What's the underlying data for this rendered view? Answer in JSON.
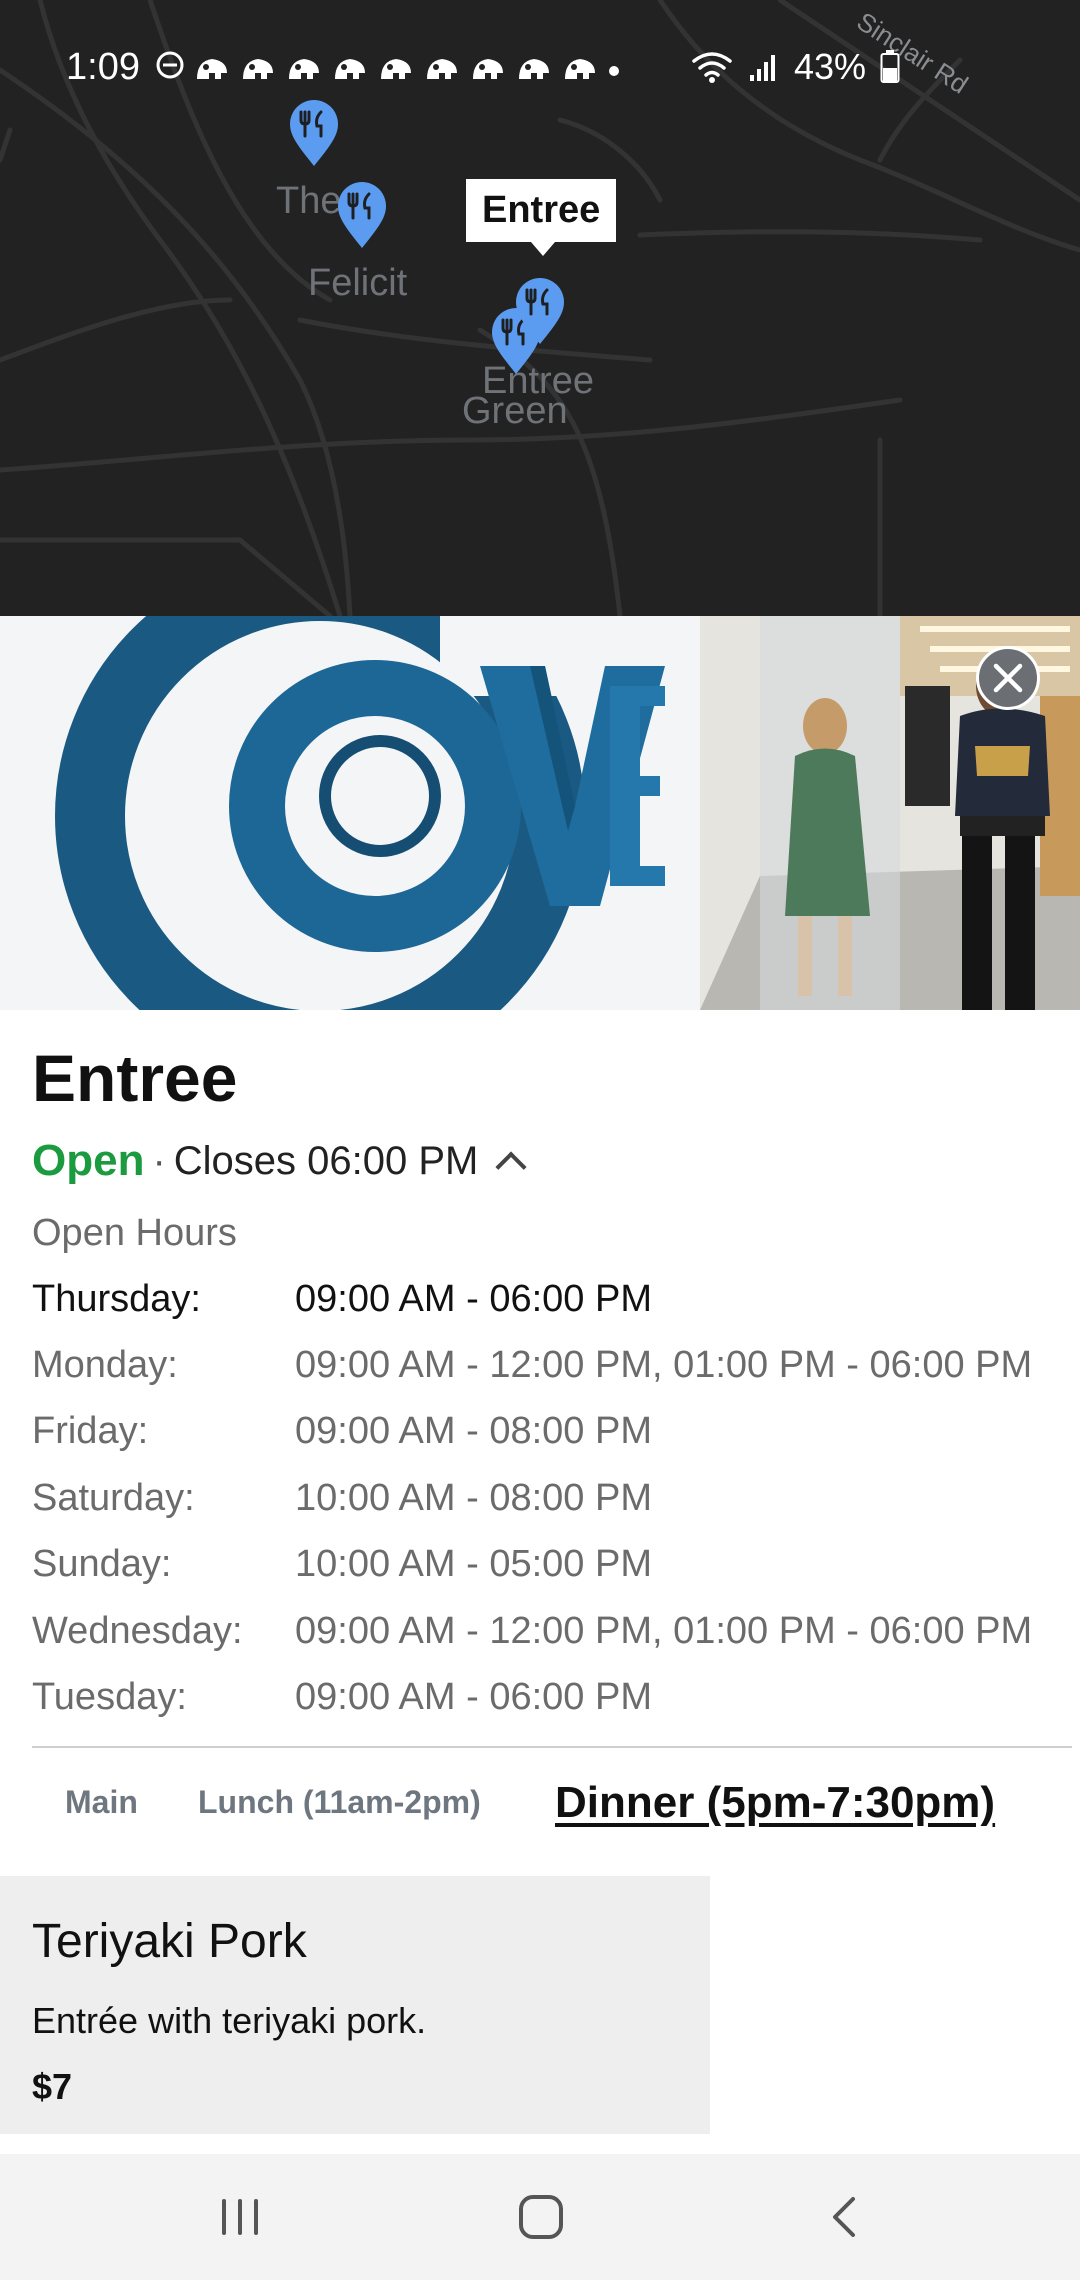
{
  "status_bar": {
    "time": "1:09",
    "battery": "43%",
    "notification_count": 9
  },
  "map": {
    "callout": "Entree",
    "road_label": "Sinclair Rd",
    "labels": [
      "The",
      "Felicit",
      "Entree",
      "Green"
    ],
    "pin_color": "#5b9cf0",
    "pin_icon": "fork-knife-icon"
  },
  "hero": {
    "sign_text": "COVE",
    "close_icon": "close-icon"
  },
  "place": {
    "name": "Entree",
    "open_state": "Open",
    "separator": "·",
    "closes_text": "Closes 06:00 PM",
    "open_color": "#1c9a3f"
  },
  "hours": {
    "heading": "Open Hours",
    "rows": [
      {
        "day": "Thursday:",
        "time": "09:00 AM - 06:00 PM"
      },
      {
        "day": "Monday:",
        "time": "09:00 AM - 12:00 PM, 01:00 PM - 06:00 PM"
      },
      {
        "day": "Friday:",
        "time": "09:00 AM - 08:00 PM"
      },
      {
        "day": "Saturday:",
        "time": "10:00 AM - 08:00 PM"
      },
      {
        "day": "Sunday:",
        "time": "10:00 AM - 05:00 PM"
      },
      {
        "day": "Wednesday:",
        "time": "09:00 AM - 12:00 PM, 01:00 PM - 06:00 PM"
      },
      {
        "day": "Tuesday:",
        "time": "09:00 AM - 06:00 PM"
      }
    ]
  },
  "tabs": [
    {
      "label": "Main",
      "active": false
    },
    {
      "label": "Lunch (11am-2pm)",
      "active": false
    },
    {
      "label": "Dinner (5pm-7:30pm)",
      "active": true
    }
  ],
  "menu_items": [
    {
      "name": "Teriyaki Pork",
      "description": "Entrée with teriyaki pork.",
      "price": "$7"
    }
  ],
  "navbar": {
    "recents_icon": "recents-icon",
    "home_icon": "home-icon",
    "back_icon": "back-icon"
  }
}
